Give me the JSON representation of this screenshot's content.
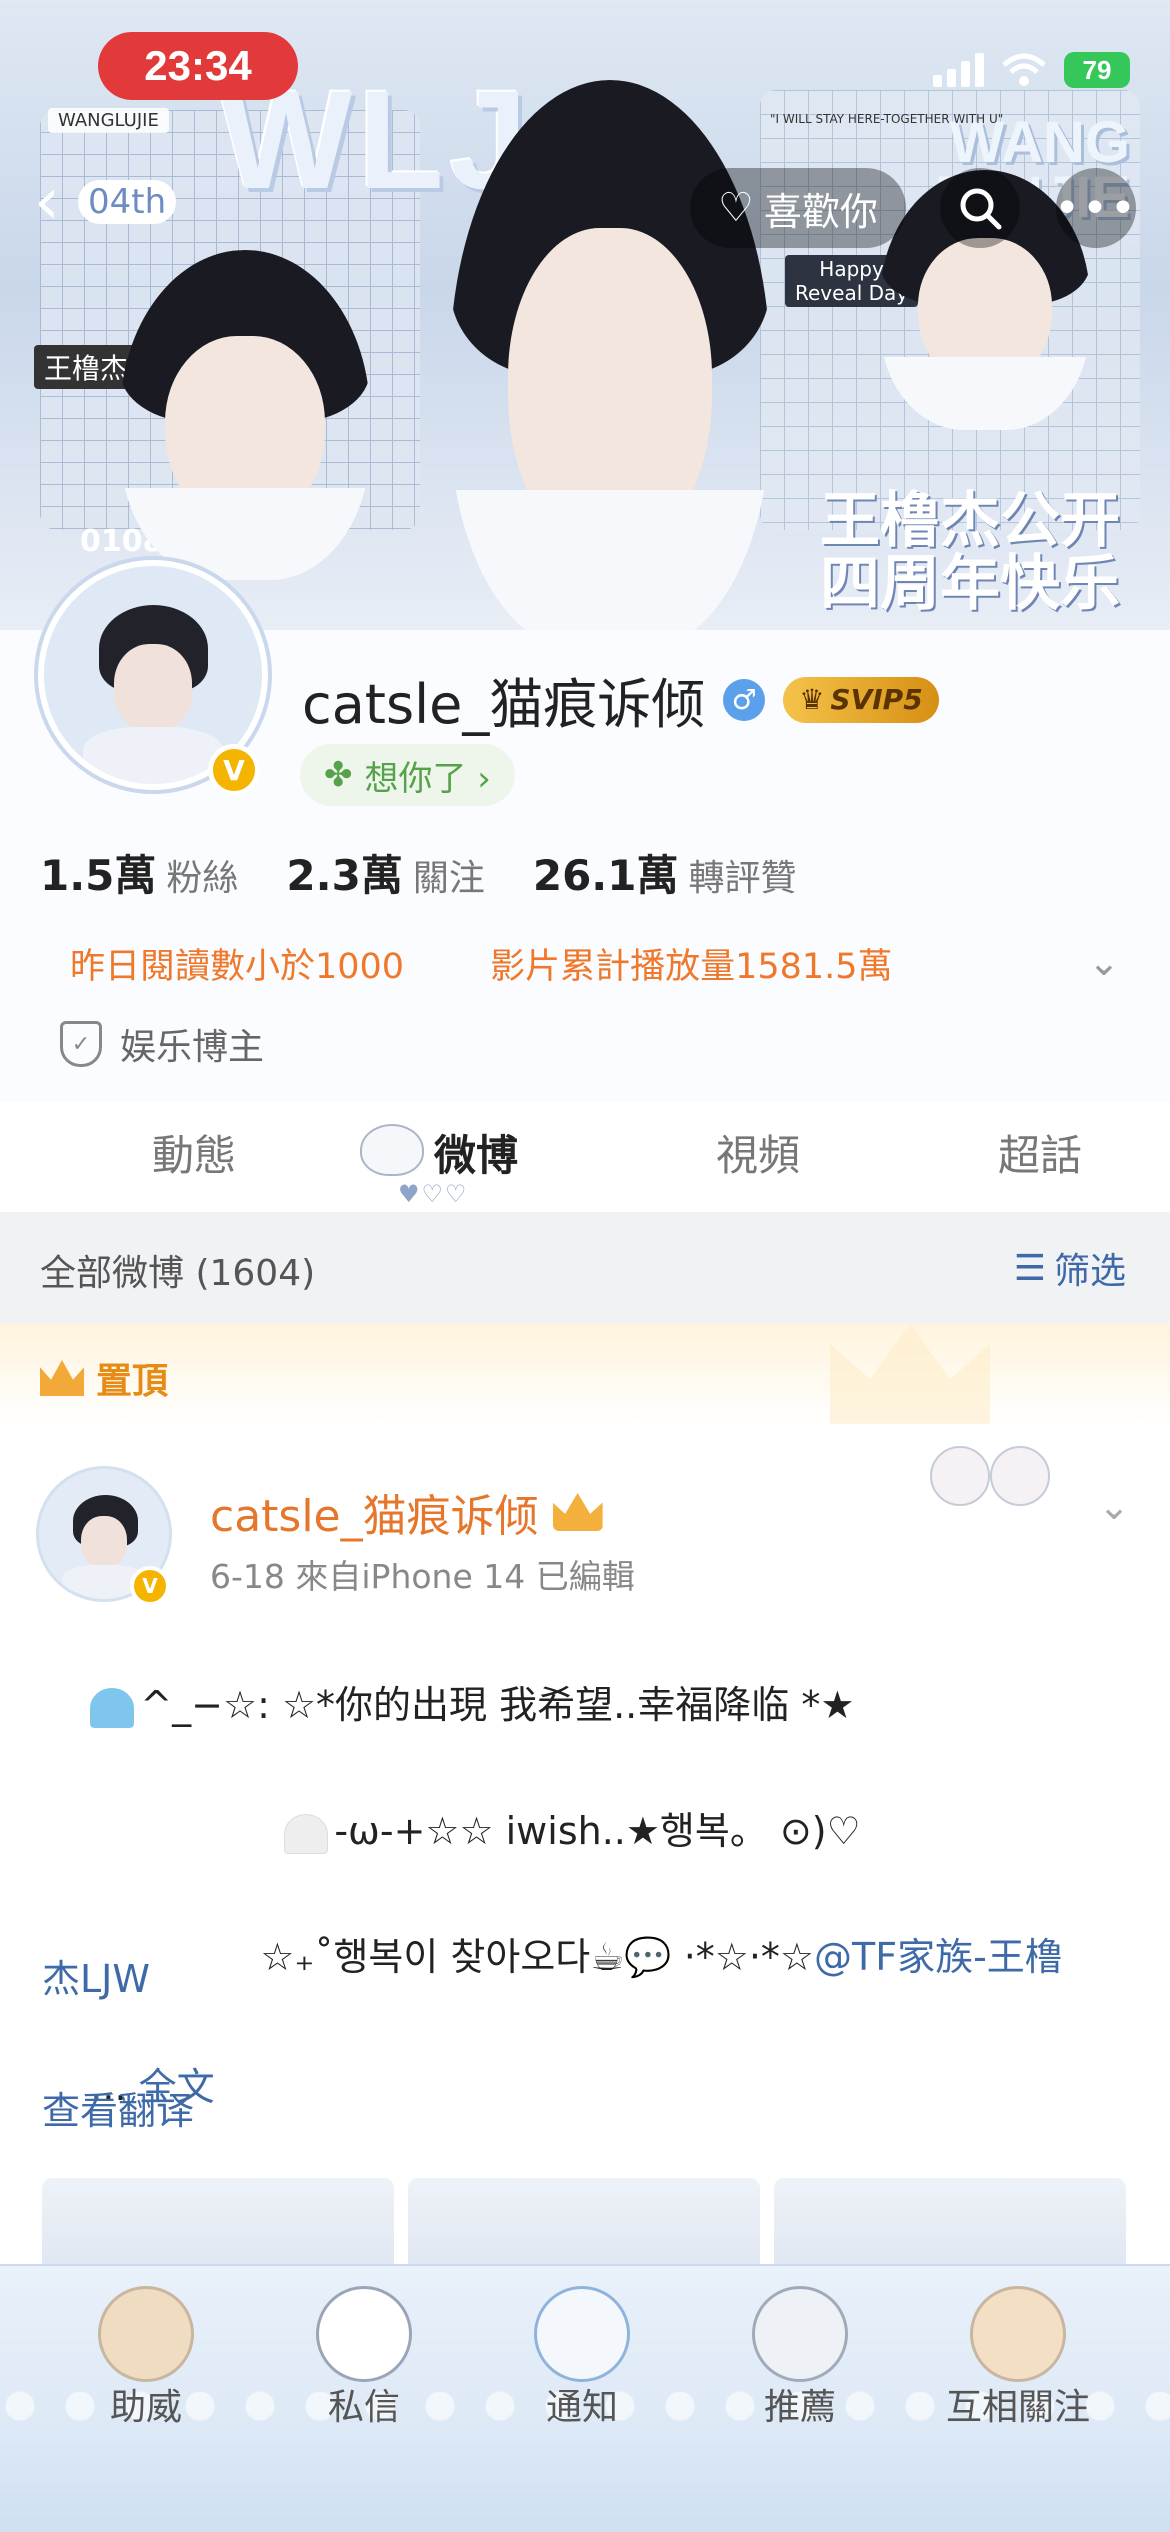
{
  "status_bar": {
    "time": "23:34",
    "battery": "79"
  },
  "banner": {
    "header_actions": {
      "like_label": "喜歡你"
    },
    "decor": {
      "main_title": "WLJ",
      "side_title": "WANG\nJUNJIE",
      "tag_wanglujie": "WANGLUJIE",
      "tag_04th": "04th",
      "tag_name": "王橹杰",
      "tag_0108": "0108",
      "tag_happy": "Happy\nReveal Day",
      "slogan_top": "\"I WILL STAY HERE-TOGETHER WITH U\"",
      "anniversary": "王橹杰公开\n四周年快乐"
    }
  },
  "profile": {
    "username": "catsle_猫痕诉倾",
    "gender_icon": "male-icon",
    "vip_label": "SVIP5",
    "verified": "V",
    "mood_label": "想你了 ›",
    "stats": [
      {
        "num": "1.5萬",
        "label": "粉絲"
      },
      {
        "num": "2.3萬",
        "label": "關注"
      },
      {
        "num": "26.1萬",
        "label": "轉評贊"
      }
    ],
    "highlights": [
      "昨日閱讀數小於1000",
      "影片累計播放量1581.5萬"
    ],
    "role": "娱乐博主"
  },
  "tabs": [
    {
      "label": "動態",
      "active": false
    },
    {
      "label": "微博",
      "active": true
    },
    {
      "label": "視頻",
      "active": false
    },
    {
      "label": "超話",
      "active": false
    }
  ],
  "filter": {
    "title": "全部微博 (1604)",
    "button": "筛选"
  },
  "pinned": {
    "label": "置頂"
  },
  "post": {
    "author": "catsle_猫痕诉倾",
    "meta": "6-18  來自iPhone 14  已編輯",
    "line1": "^_−☆: ☆*你的出現 我希望..幸福降临 *★",
    "line2": "-ω-+☆☆ iwish..★행복。 ⊙)♡",
    "line3": "☆₊˚행복이 찾아오다☕💬 ‧*☆‧*☆",
    "mention_a": "@TF家族-王橹",
    "mention_b": "杰LJW",
    "ellipsis": "... ",
    "more": "全文",
    "translate": "查看翻译"
  },
  "bottom_nav": [
    {
      "label": "助威",
      "icon": "bear-icon"
    },
    {
      "label": "私信",
      "icon": "cat-icon"
    },
    {
      "label": "通知",
      "icon": "kitten-bow-icon"
    },
    {
      "label": "推薦",
      "icon": "sticker-icon"
    },
    {
      "label": "互相關注",
      "icon": "bear-doll-icon"
    }
  ],
  "colors": {
    "accent_orange": "#f0782a",
    "link_blue": "#3e68a8",
    "time_red": "#e23a3a",
    "battery_green": "#35c759"
  }
}
